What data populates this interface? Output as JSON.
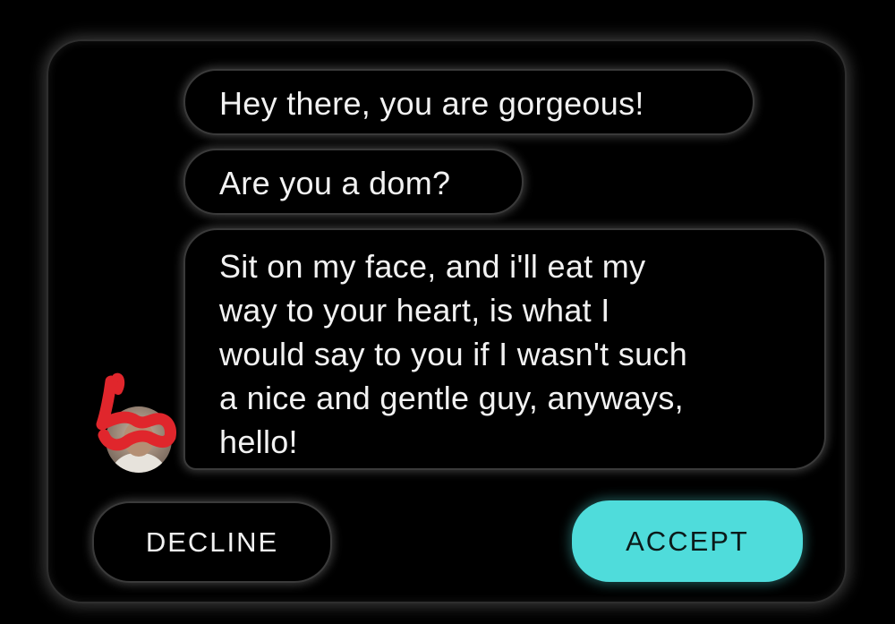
{
  "messages": [
    {
      "text": "Hey there, you are gorgeous!"
    },
    {
      "text": "Are you a dom?"
    },
    {
      "lines": [
        "Sit on my face, and i'll eat my",
        "way to your heart, is what I",
        "would say to you if I wasn't such",
        "a nice and gentle guy, anyways,",
        "hello!"
      ]
    }
  ],
  "actions": {
    "decline_label": "DECLINE",
    "accept_label": "ACCEPT"
  },
  "colors": {
    "accent": "#4fdcdb",
    "background": "#000000",
    "text": "#f2f2f2",
    "redaction": "#e0262c"
  },
  "icons": {
    "avatar": "sender-avatar"
  }
}
